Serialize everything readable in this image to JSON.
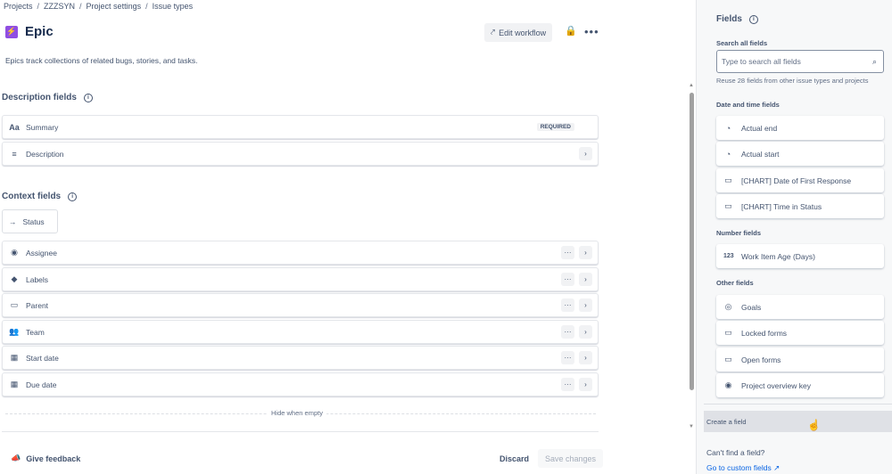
{
  "breadcrumb": [
    "Projects",
    "ZZZSYN",
    "Project settings",
    "Issue types"
  ],
  "page": {
    "title": "Epic",
    "description": "Epics track collections of related bugs, stories, and tasks.",
    "edit_workflow_label": "Edit workflow"
  },
  "description_fields": {
    "label": "Description fields",
    "items": [
      {
        "icon": "text-format-icon",
        "label": "Summary",
        "badge": "REQUIRED"
      },
      {
        "icon": "description-icon",
        "label": "Description"
      }
    ]
  },
  "context_fields": {
    "label": "Context fields",
    "status_chip": "Status",
    "items": [
      {
        "icon": "person-icon",
        "label": "Assignee"
      },
      {
        "icon": "tag-icon",
        "label": "Labels"
      },
      {
        "icon": "field-icon",
        "label": "Parent"
      },
      {
        "icon": "team-icon",
        "label": "Team"
      },
      {
        "icon": "calendar-icon",
        "label": "Start date"
      },
      {
        "icon": "calendar-icon",
        "label": "Due date"
      }
    ],
    "hide_when_empty": "Hide when empty"
  },
  "footer": {
    "feedback_label": "Give feedback",
    "discard_label": "Discard",
    "save_label": "Save changes"
  },
  "panel": {
    "title": "Fields",
    "search_label": "Search all fields",
    "search_placeholder": "Type to search all fields",
    "reuse_text": "Reuse 28 fields from other issue types and projects",
    "groups": [
      {
        "label": "Date and time fields",
        "items": [
          {
            "icon": "clock-icon",
            "label": "Actual end"
          },
          {
            "icon": "clock-icon",
            "label": "Actual start"
          },
          {
            "icon": "field-icon",
            "label": "[CHART] Date of First Response"
          },
          {
            "icon": "field-icon",
            "label": "[CHART] Time in Status"
          }
        ]
      },
      {
        "label": "Number fields",
        "items": [
          {
            "icon": "number-icon",
            "label": "Work Item Age (Days)"
          }
        ]
      },
      {
        "label": "Other fields",
        "items": [
          {
            "icon": "goal-icon",
            "label": "Goals"
          },
          {
            "icon": "field-icon",
            "label": "Locked forms"
          },
          {
            "icon": "field-icon",
            "label": "Open forms"
          },
          {
            "icon": "project-key-icon",
            "label": "Project overview key"
          }
        ]
      }
    ],
    "create_field_label": "Create a field",
    "cant_find_text": "Can't find a field?",
    "custom_fields_link": "Go to custom fields"
  },
  "colors": {
    "epic": "#904ee2",
    "link": "#0c66e4",
    "text": "#172b4d",
    "subtle_text": "#44546f"
  }
}
